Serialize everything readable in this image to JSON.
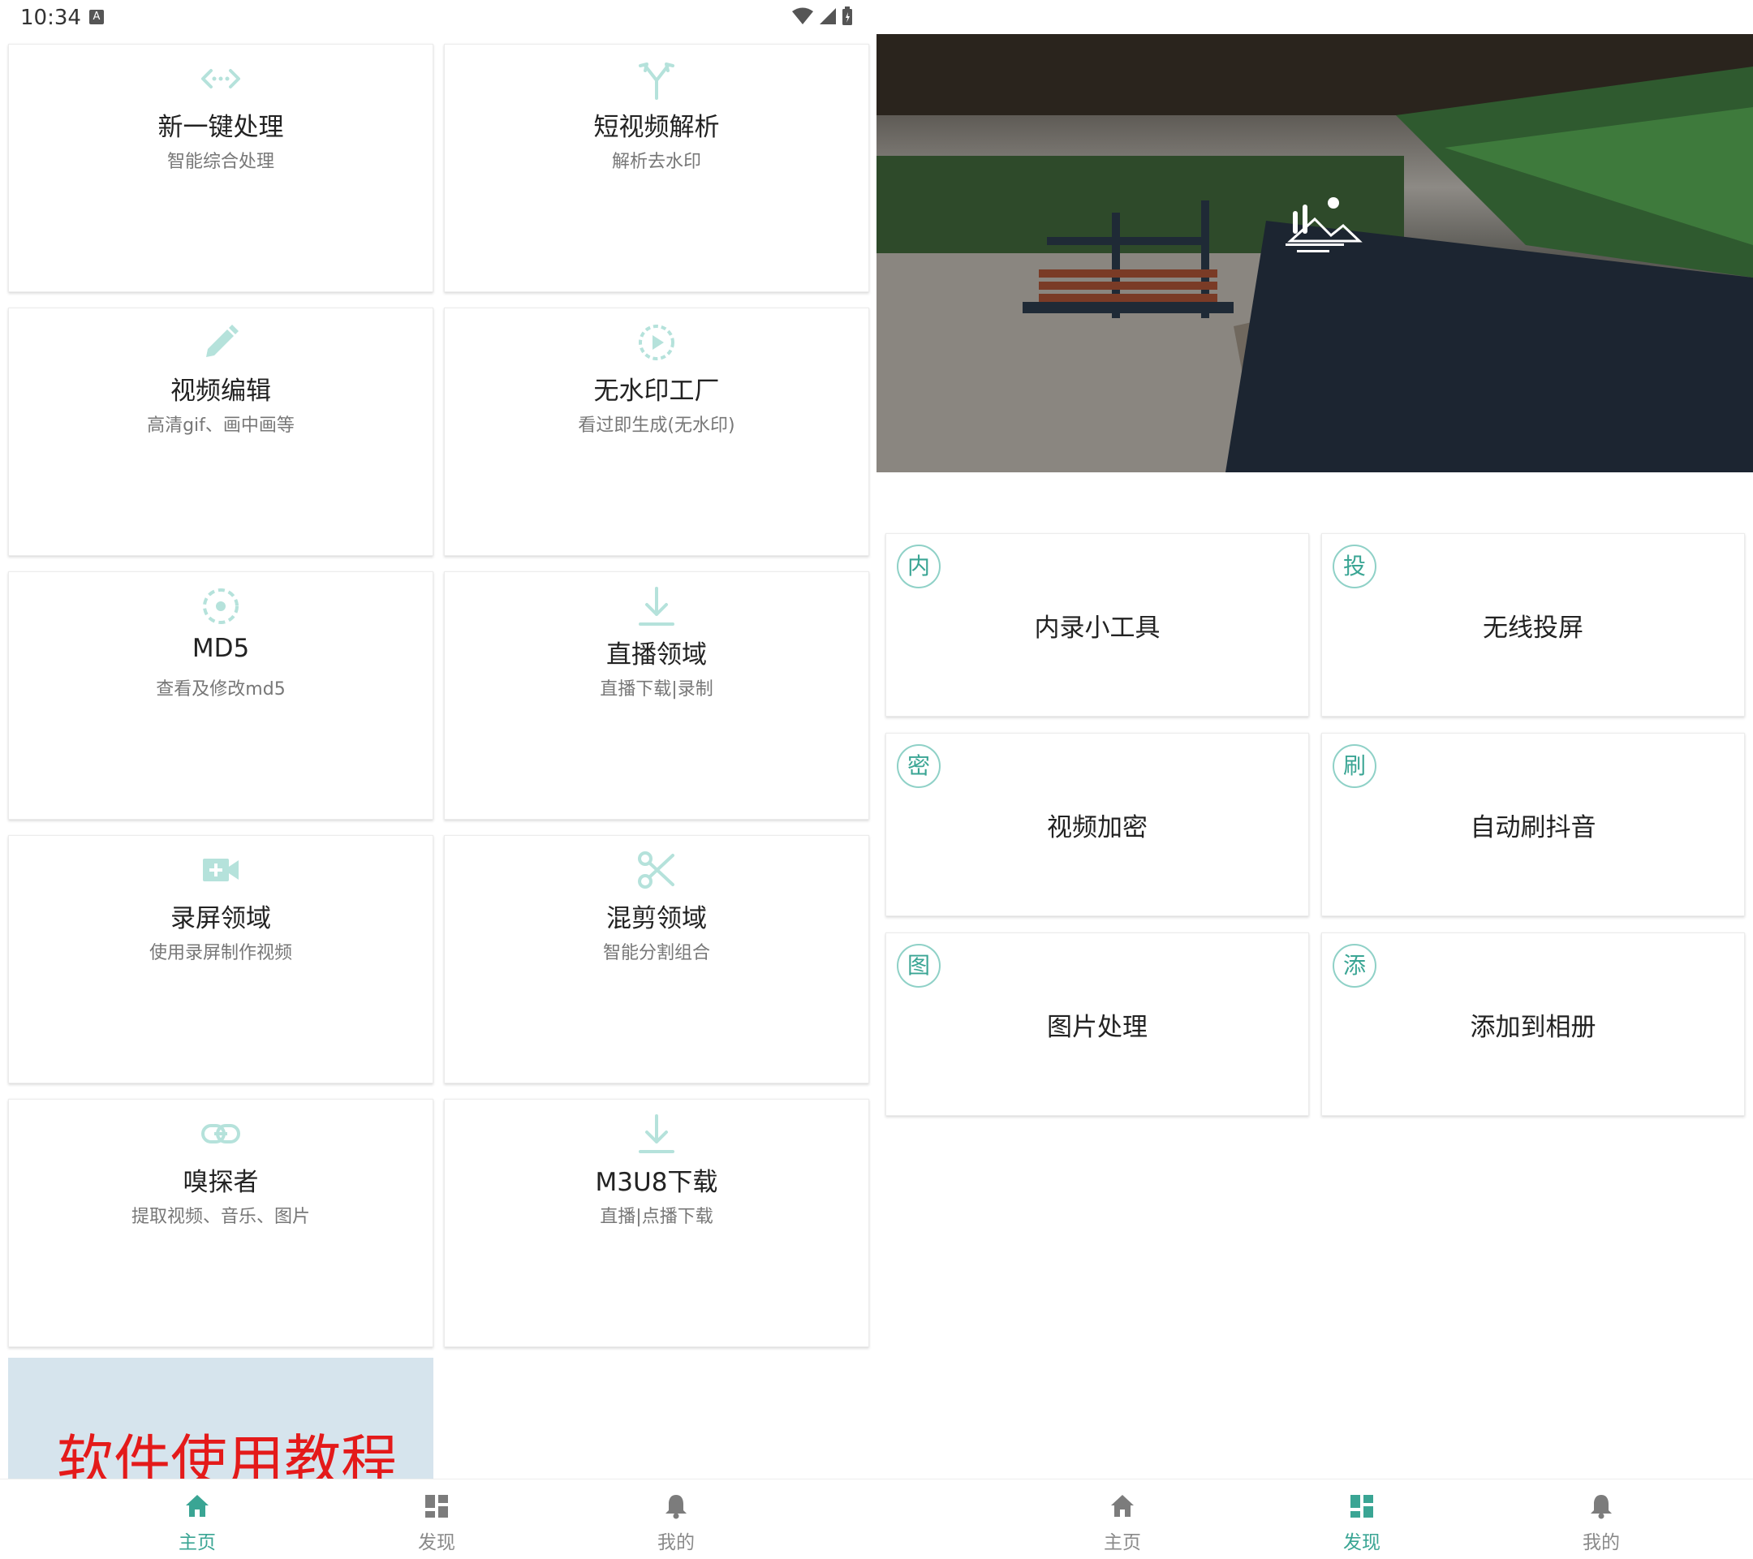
{
  "status": {
    "time": "10:34"
  },
  "colors": {
    "accent": "#3aa594",
    "icon_tint": "#b5e2db",
    "promo_text": "#e41a1a"
  },
  "home": {
    "tools": [
      {
        "title": "新一键处理",
        "subtitle": "智能综合处理",
        "icon": "code-arrows-icon"
      },
      {
        "title": "短视频解析",
        "subtitle": "解析去水印",
        "icon": "split-arrows-icon"
      },
      {
        "title": "视频编辑",
        "subtitle": "高清gif、画中画等",
        "icon": "pencil-icon"
      },
      {
        "title": "无水印工厂",
        "subtitle": "看过即生成(无水印)",
        "icon": "play-circle-icon"
      },
      {
        "title": "MD5",
        "subtitle": "查看及修改md5",
        "icon": "target-icon"
      },
      {
        "title": "直播领域",
        "subtitle": "直播下载|录制",
        "icon": "download-icon"
      },
      {
        "title": "录屏领域",
        "subtitle": "使用录屏制作视频",
        "icon": "video-add-icon"
      },
      {
        "title": "混剪领域",
        "subtitle": "智能分割组合",
        "icon": "scissors-icon"
      },
      {
        "title": "嗅探者",
        "subtitle": "提取视频、音乐、图片",
        "icon": "link-icon"
      },
      {
        "title": "M3U8下载",
        "subtitle": "直播|点播下载",
        "icon": "download-icon"
      }
    ],
    "promo_text": "软件使用教程"
  },
  "discover": {
    "items": [
      {
        "badge": "内",
        "title": "内录小工具"
      },
      {
        "badge": "投",
        "title": "无线投屏"
      },
      {
        "badge": "密",
        "title": "视频加密"
      },
      {
        "badge": "刷",
        "title": "自动刷抖音"
      },
      {
        "badge": "图",
        "title": "图片处理"
      },
      {
        "badge": "添",
        "title": "添加到相册"
      }
    ]
  },
  "nav_left": [
    {
      "label": "主页",
      "icon": "home-icon",
      "active": true
    },
    {
      "label": "发现",
      "icon": "dashboard-icon",
      "active": false
    },
    {
      "label": "我的",
      "icon": "bell-icon",
      "active": false
    }
  ],
  "nav_right": [
    {
      "label": "主页",
      "icon": "home-icon",
      "active": false
    },
    {
      "label": "发现",
      "icon": "dashboard-icon",
      "active": true
    },
    {
      "label": "我的",
      "icon": "bell-icon",
      "active": false
    }
  ]
}
